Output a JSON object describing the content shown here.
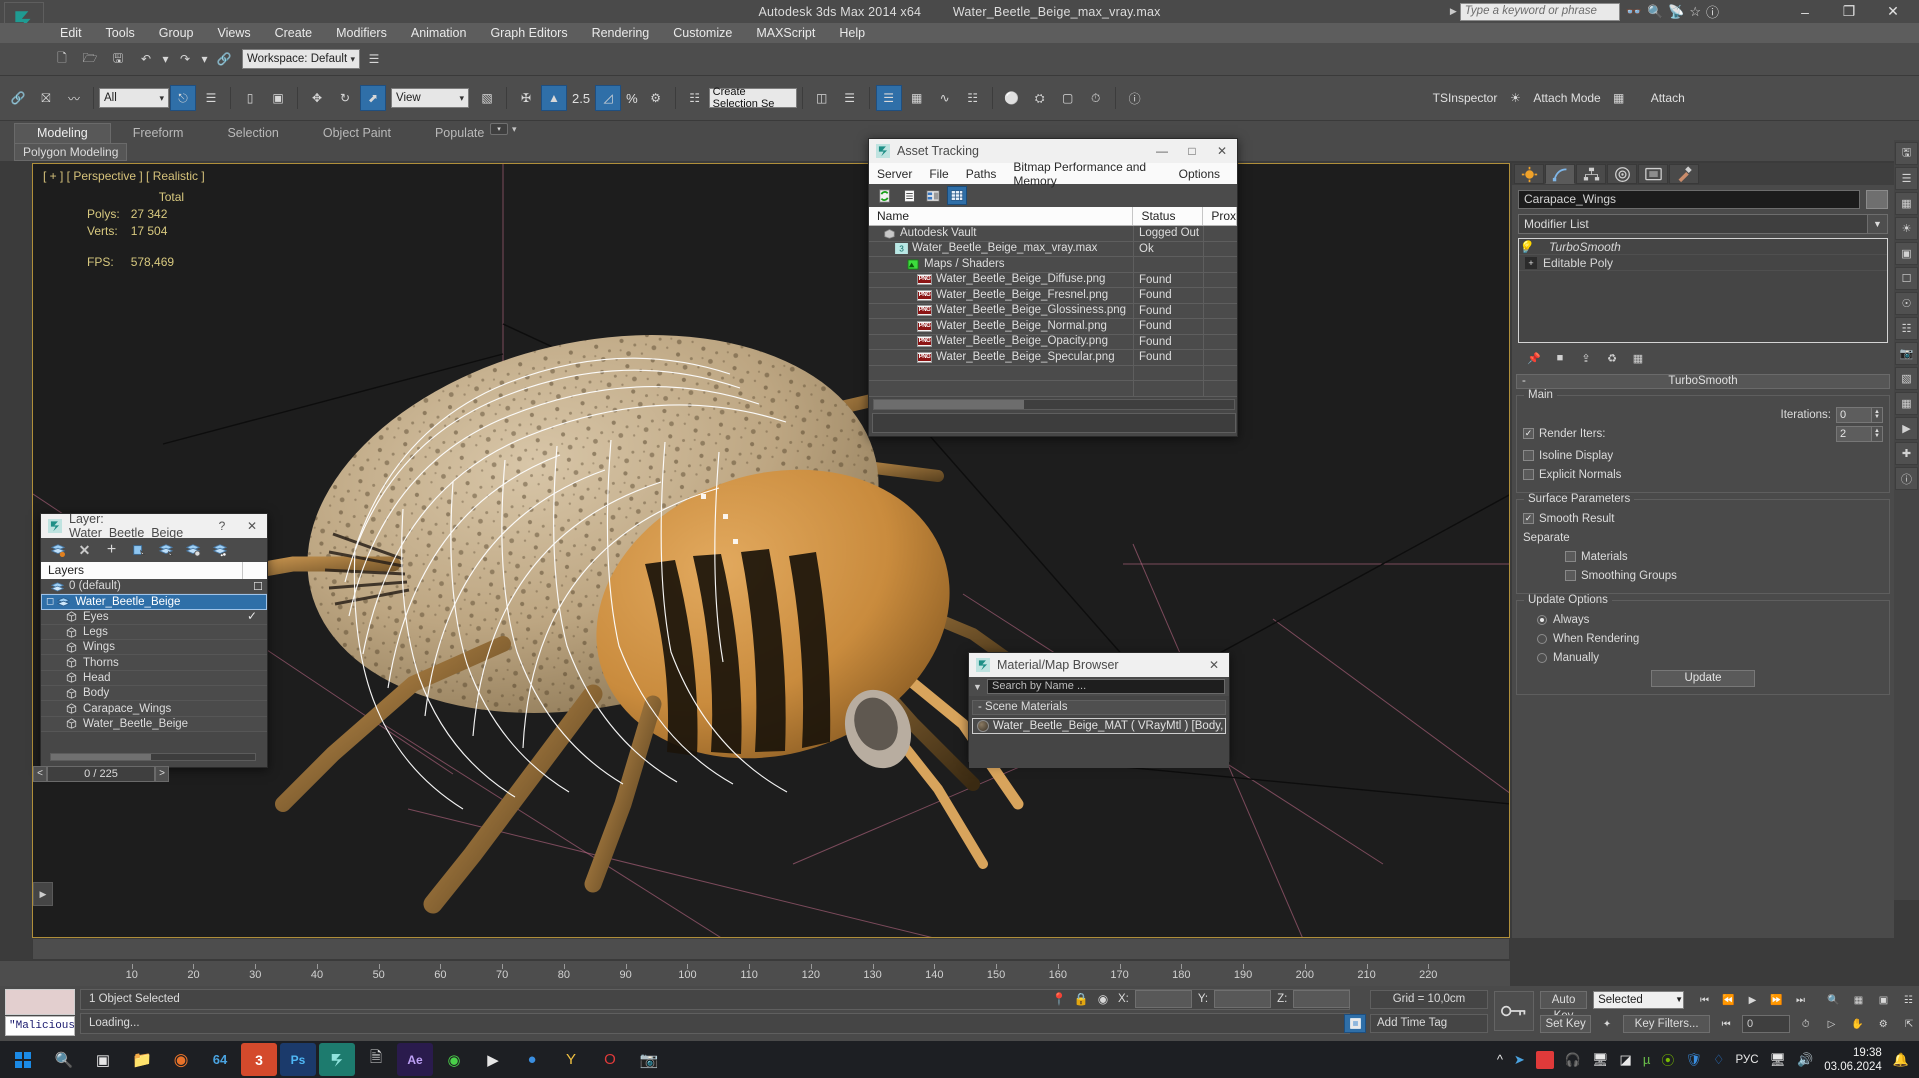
{
  "titlebar": {
    "app_title": "Autodesk 3ds Max  2014 x64",
    "file_title": "Water_Beetle_Beige_max_vray.max",
    "workspace_label": "Workspace: Default",
    "search_placeholder": "Type a keyword or phrase",
    "minimize": "–",
    "maximize": "❐",
    "close": "✕"
  },
  "menubar": {
    "items": [
      "Edit",
      "Tools",
      "Group",
      "Views",
      "Create",
      "Modifiers",
      "Animation",
      "Graph Editors",
      "Rendering",
      "Customize",
      "MAXScript",
      "Help"
    ]
  },
  "toolbar": {
    "selection_filter": "All",
    "ref_coord_system": "View",
    "named_selection_sets": "Create Selection Se",
    "angle_snap_value": "2.5",
    "percent_label": "%",
    "tsinspector_label": "TSInspector",
    "attach_mode_label": "Attach Mode",
    "attach_label": "Attach"
  },
  "ribbon": {
    "tabs": [
      "Modeling",
      "Freeform",
      "Selection",
      "Object Paint",
      "Populate"
    ],
    "active_tab": "Modeling",
    "panel_label": "Polygon Modeling"
  },
  "viewport": {
    "label": "[ + ] [ Perspective ] [ Realistic ]",
    "stats": {
      "header": "Total",
      "polys_label": "Polys:",
      "polys_value": "27 342",
      "verts_label": "Verts:",
      "verts_value": "17 504",
      "fps_label": "FPS:",
      "fps_value": "578,469"
    }
  },
  "asset_tracking": {
    "title": "Asset Tracking",
    "menu": [
      "Server",
      "File",
      "Paths",
      "Bitmap Performance and Memory",
      "Options"
    ],
    "columns": [
      "Name",
      "Status",
      "Prox"
    ],
    "rows": [
      {
        "name": "Autodesk Vault",
        "status": "Logged Out ...",
        "icon": "vault-icon",
        "indent": 1
      },
      {
        "name": "Water_Beetle_Beige_max_vray.max",
        "status": "Ok",
        "icon": "max-file-icon",
        "indent": 2
      },
      {
        "name": "Maps / Shaders",
        "status": "",
        "icon": "maps-icon",
        "indent": 3
      },
      {
        "name": "Water_Beetle_Beige_Diffuse.png",
        "status": "Found",
        "icon": "png-icon",
        "indent": 4
      },
      {
        "name": "Water_Beetle_Beige_Fresnel.png",
        "status": "Found",
        "icon": "png-icon",
        "indent": 4
      },
      {
        "name": "Water_Beetle_Beige_Glossiness.png",
        "status": "Found",
        "icon": "png-icon",
        "indent": 4
      },
      {
        "name": "Water_Beetle_Beige_Normal.png",
        "status": "Found",
        "icon": "png-icon",
        "indent": 4
      },
      {
        "name": "Water_Beetle_Beige_Opacity.png",
        "status": "Found",
        "icon": "png-icon",
        "indent": 4
      },
      {
        "name": "Water_Beetle_Beige_Specular.png",
        "status": "Found",
        "icon": "png-icon",
        "indent": 4
      }
    ]
  },
  "layer_dialog": {
    "title": "Layer: Water_Beetle_Beige",
    "help_btn": "?",
    "close_btn": "✕",
    "list_header": "Layers",
    "rows": [
      {
        "label": "0 (default)",
        "type": "layer",
        "selected": false,
        "mark": "box"
      },
      {
        "label": "Water_Beetle_Beige",
        "type": "layer",
        "selected": true,
        "mark": "check"
      },
      {
        "label": "Eyes",
        "type": "object",
        "selected": false,
        "mark": ""
      },
      {
        "label": "Legs",
        "type": "object",
        "selected": false,
        "mark": ""
      },
      {
        "label": "Wings",
        "type": "object",
        "selected": false,
        "mark": ""
      },
      {
        "label": "Thorns",
        "type": "object",
        "selected": false,
        "mark": ""
      },
      {
        "label": "Head",
        "type": "object",
        "selected": false,
        "mark": ""
      },
      {
        "label": "Body",
        "type": "object",
        "selected": false,
        "mark": ""
      },
      {
        "label": "Carapace_Wings",
        "type": "object",
        "selected": false,
        "mark": ""
      },
      {
        "label": "Water_Beetle_Beige",
        "type": "object",
        "selected": false,
        "mark": ""
      }
    ]
  },
  "material_browser": {
    "title": "Material/Map Browser",
    "close_btn": "✕",
    "search_placeholder": "Search by Name ...",
    "group_label": "- Scene Materials",
    "item_label": "Water_Beetle_Beige_MAT ( VRayMtl ) [Body, Car..."
  },
  "command_panel": {
    "object_name": "Carapace_Wings",
    "modifier_list_label": "Modifier List",
    "stack": [
      {
        "label": "TurboSmooth",
        "italic": true
      },
      {
        "label": "Editable Poly",
        "italic": false,
        "expand": "+"
      }
    ],
    "rollout_title": "TurboSmooth",
    "rollout_mark": "-",
    "main_group": "Main",
    "iterations_label": "Iterations:",
    "iterations_value": "0",
    "render_iters_label": "Render Iters:",
    "render_iters_value": "2",
    "render_iters_checked": true,
    "isoline_label": "Isoline Display",
    "isoline_checked": false,
    "explicit_normals_label": "Explicit Normals",
    "explicit_normals_checked": false,
    "surface_group": "Surface Parameters",
    "smooth_result_label": "Smooth Result",
    "smooth_result_checked": true,
    "separate_label": "Separate",
    "materials_label": "Materials",
    "materials_checked": false,
    "smoothing_groups_label": "Smoothing Groups",
    "smoothing_groups_checked": false,
    "update_group": "Update Options",
    "update_options": [
      "Always",
      "When Rendering",
      "Manually"
    ],
    "update_selected": "Always",
    "update_button": "Update"
  },
  "timeline": {
    "frame_counter": "0 / 225",
    "prev_btn": "<",
    "next_btn": ">",
    "ruler_ticks": [
      "10",
      "20",
      "30",
      "40",
      "50",
      "60",
      "70",
      "80",
      "90",
      "100",
      "110",
      "120",
      "130",
      "140",
      "150",
      "160",
      "170",
      "180",
      "190",
      "200",
      "210",
      "220"
    ]
  },
  "statusbar": {
    "script_listener": "\"Malicious s",
    "line1": "1 Object Selected",
    "line2": "Loading...",
    "x_label": "X:",
    "y_label": "Y:",
    "z_label": "Z:",
    "x_value": "",
    "y_value": "",
    "z_value": "",
    "grid_label": "Grid = 10,0cm",
    "add_time_tag": "Add Time Tag"
  },
  "animation": {
    "auto_key": "Auto Key",
    "set_key": "Set Key",
    "key_mode": "Selected",
    "key_filters": "Key Filters...",
    "current_frame": "0"
  },
  "taskbar": {
    "language": "РУС",
    "time": "19:38",
    "date": "03.06.2024"
  },
  "colors": {
    "accent_blue": "#2f6fa8",
    "viewport_border": "#b08f3a",
    "panel_bg": "#4a4a4a",
    "stat_yellow": "#d8c97f"
  }
}
